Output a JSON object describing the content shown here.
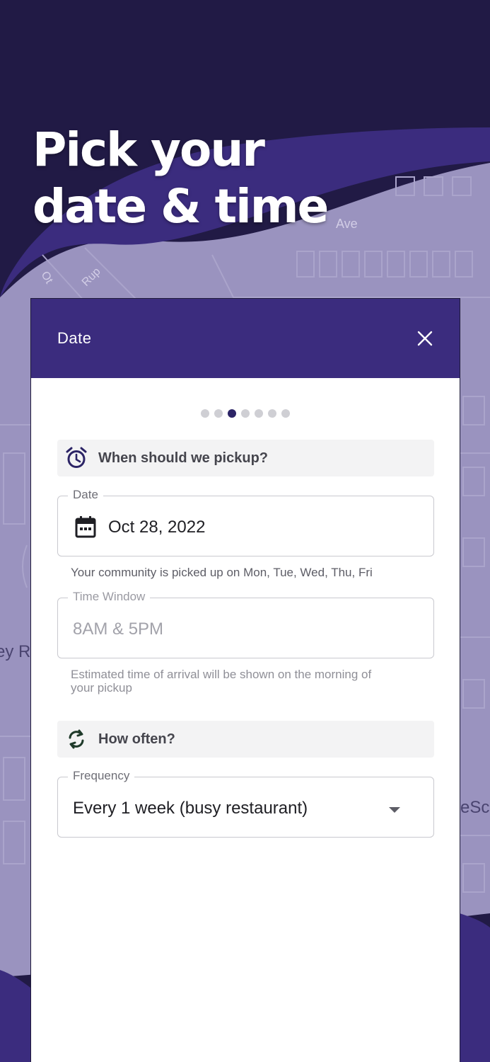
{
  "hero": {
    "title": "Pick your\ndate & time"
  },
  "map": {
    "street_ave": "Ave",
    "street_rup": "Rup",
    "street_ot": "Ot",
    "street_eyr": "ey R",
    "street_esc": "eSc"
  },
  "modal": {
    "title": "Date",
    "close_icon": "close-icon",
    "steps": {
      "total": 7,
      "active": 3
    },
    "pickup_section": {
      "icon": "alarm-clock-icon",
      "label": "When should we pickup?"
    },
    "date_field": {
      "legend": "Date",
      "icon": "calendar-icon",
      "value": "Oct 28, 2022"
    },
    "date_helper": "Your community is picked up on Mon, Tue, Wed, Thu, Fri",
    "time_field": {
      "legend": "Time Window",
      "value": "8AM & 5PM"
    },
    "time_helper": "Estimated time of arrival will be shown on the morning of\nyour pickup",
    "often_section": {
      "icon": "refresh-icon",
      "label": "How often?"
    },
    "frequency_field": {
      "legend": "Frequency",
      "value": "Every 1 week (busy restaurant)",
      "icon": "dropdown-arrow-icon"
    }
  },
  "colors": {
    "dark_bg": "#211a45",
    "brand_purple": "#3b2c7e",
    "map_purple": "#9a93bf",
    "step_active": "#2c2466"
  }
}
